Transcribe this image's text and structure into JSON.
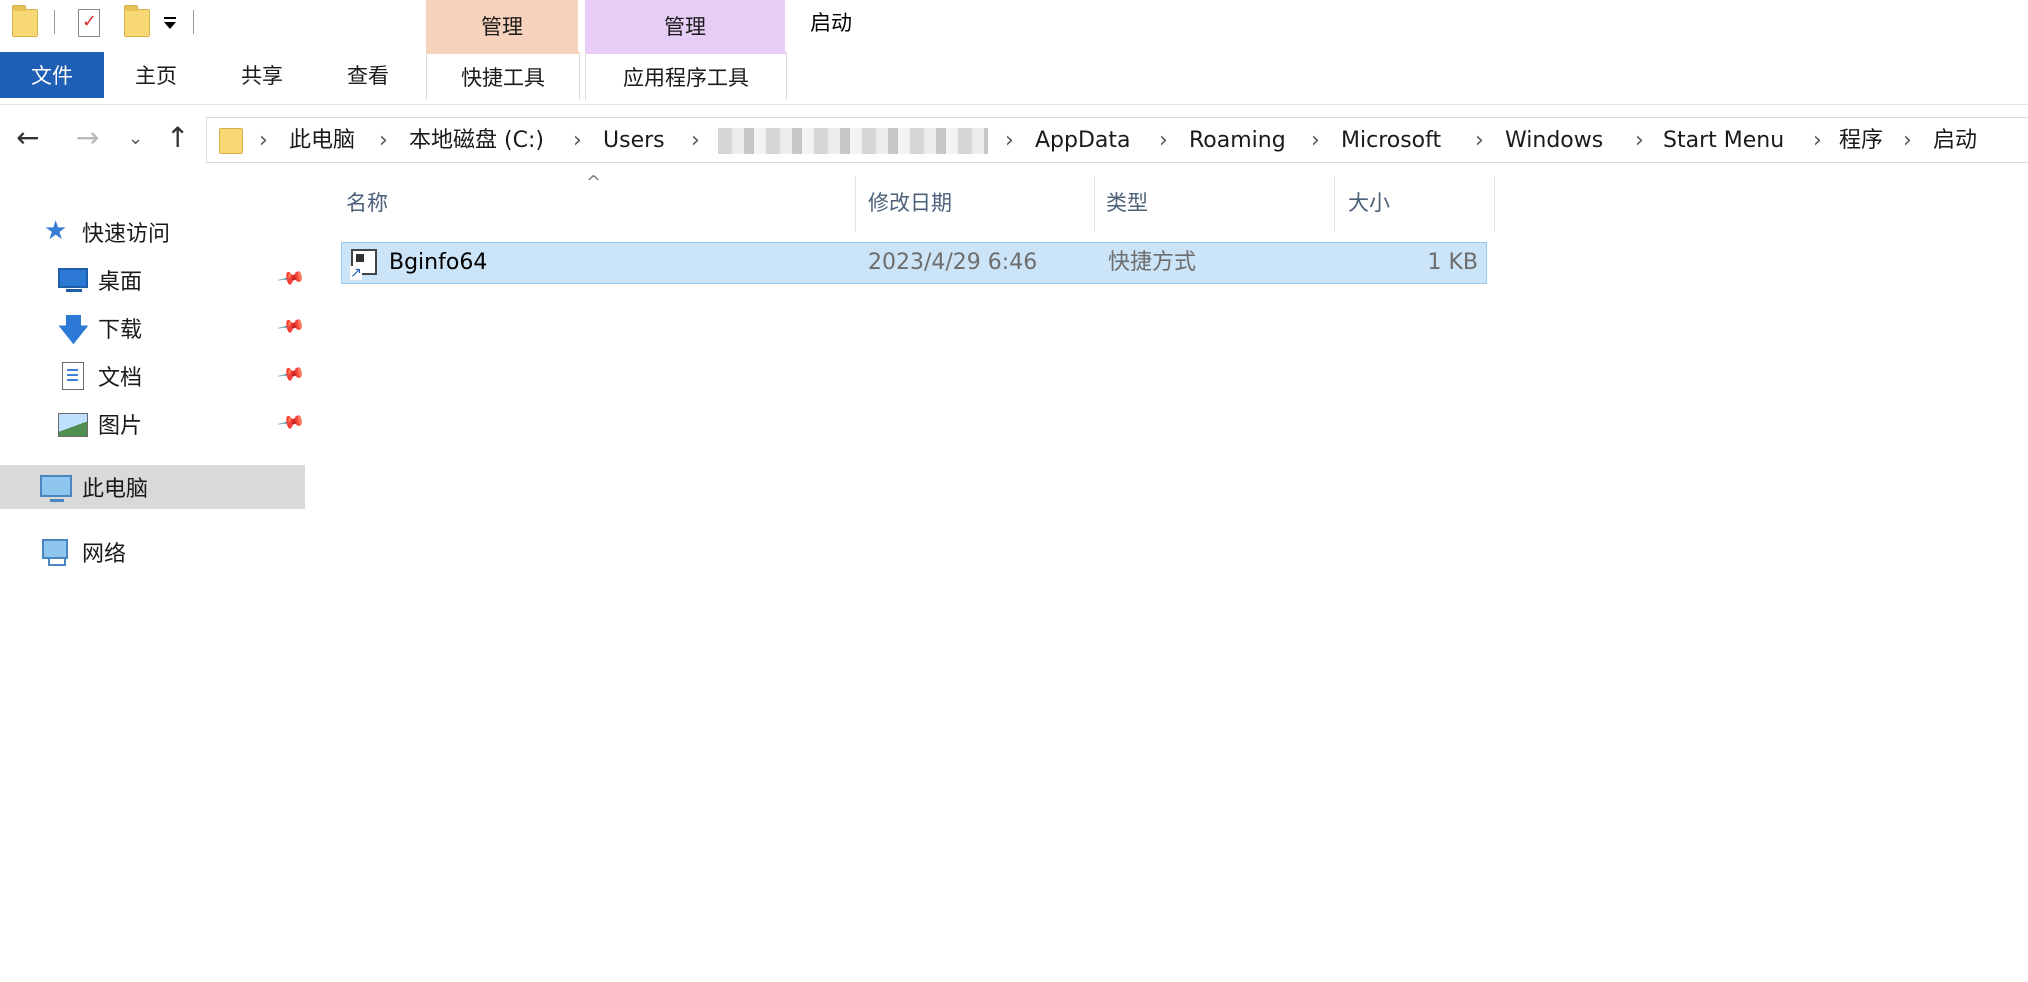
{
  "quick_access_toolbar": {
    "icons": [
      "folder-icon",
      "properties-icon",
      "new-folder-icon",
      "customize-dropdown-icon"
    ]
  },
  "contextual_tabs": {
    "shortcut_tools_header": "管理",
    "app_tools_header": "管理"
  },
  "window_title": "启动",
  "ribbon": {
    "tabs": [
      "文件",
      "主页",
      "共享",
      "查看",
      "快捷工具",
      "应用程序工具"
    ]
  },
  "address_bar": {
    "path": [
      "此电脑",
      "本地磁盘 (C:)",
      "Users",
      "AppData",
      "Roaming",
      "Microsoft",
      "Windows",
      "Start Menu",
      "程序",
      "启动"
    ]
  },
  "nav_pane": {
    "quick_access": "快速访问",
    "pinned": [
      "桌面",
      "下载",
      "文档",
      "图片"
    ],
    "this_pc": "此电脑",
    "network": "网络"
  },
  "file_list": {
    "columns": [
      "名称",
      "修改日期",
      "类型",
      "大小"
    ],
    "rows": [
      {
        "name": "Bginfo64",
        "modified": "2023/4/29 6:46",
        "type": "快捷方式",
        "size": "1 KB"
      }
    ]
  },
  "colors": {
    "file_tab": "#1f5fb5",
    "shortcut_tools_accent": "#f7d3be",
    "app_tools_accent": "#e7cdf6",
    "selected_row": "#cce4f7",
    "selected_nav": "#d9d9d9"
  }
}
